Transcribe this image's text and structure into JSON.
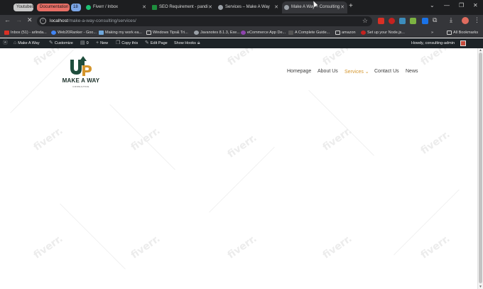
{
  "colors": {
    "tab_bar": "#1d1e20",
    "toolbar": "#35363a",
    "admin_bar": "#1d2327",
    "logo_green": "#1e4d3c",
    "logo_orange": "#d4952c",
    "menu_active": "#d4952c"
  },
  "browser": {
    "tab_groups": [
      {
        "label": "Youtubes"
      },
      {
        "label": "Documentation"
      },
      {
        "label": "18"
      }
    ],
    "tabs": [
      {
        "title": "Fiverr / Inbox",
        "icon": "fiverr-icon"
      },
      {
        "title": "SEO Requirement - pandi",
        "icon": "sheets-icon"
      },
      {
        "title": "Services – Make A Way",
        "icon": "globe-icon"
      },
      {
        "title": "Make A Way – Consulting",
        "icon": "globe-icon",
        "active": true
      }
    ],
    "url": {
      "host": "localhost",
      "path": "/make-a-way-consulting/services/"
    },
    "bookmarks": [
      {
        "label": "Inbox (51) - arlinda..."
      },
      {
        "label": "Web20Ranker - Goo..."
      },
      {
        "label": "Making my work ea..."
      },
      {
        "label": "Windows Tips& Tri..."
      },
      {
        "label": "Javanotes 8.1.3, Exe..."
      },
      {
        "label": "eCommerce App De..."
      },
      {
        "label": "A Complete Guide..."
      },
      {
        "label": "amazon"
      },
      {
        "label": "Set up your Node.js..."
      }
    ],
    "bookmarks_more": "»",
    "all_bookmarks": "All Bookmarks"
  },
  "admin_bar": {
    "site_name": "Make A Way",
    "customize": "Customize",
    "comments_count": "0",
    "new": "New",
    "copy_this": "Copy this",
    "edit_page": "Edit Page",
    "show_hooks": "Show Hooks",
    "greeting": "Howdy, consulting-admin"
  },
  "site": {
    "logo_mark": "UP",
    "logo_name": "MAKE A WAY",
    "logo_tagline": "CONSULTING",
    "menu": [
      {
        "label": "Homepage"
      },
      {
        "label": "About Us"
      },
      {
        "label": "Services ⌄",
        "active": true
      },
      {
        "label": "Contact Us"
      },
      {
        "label": "News"
      }
    ]
  },
  "watermark_text": "fiverr."
}
